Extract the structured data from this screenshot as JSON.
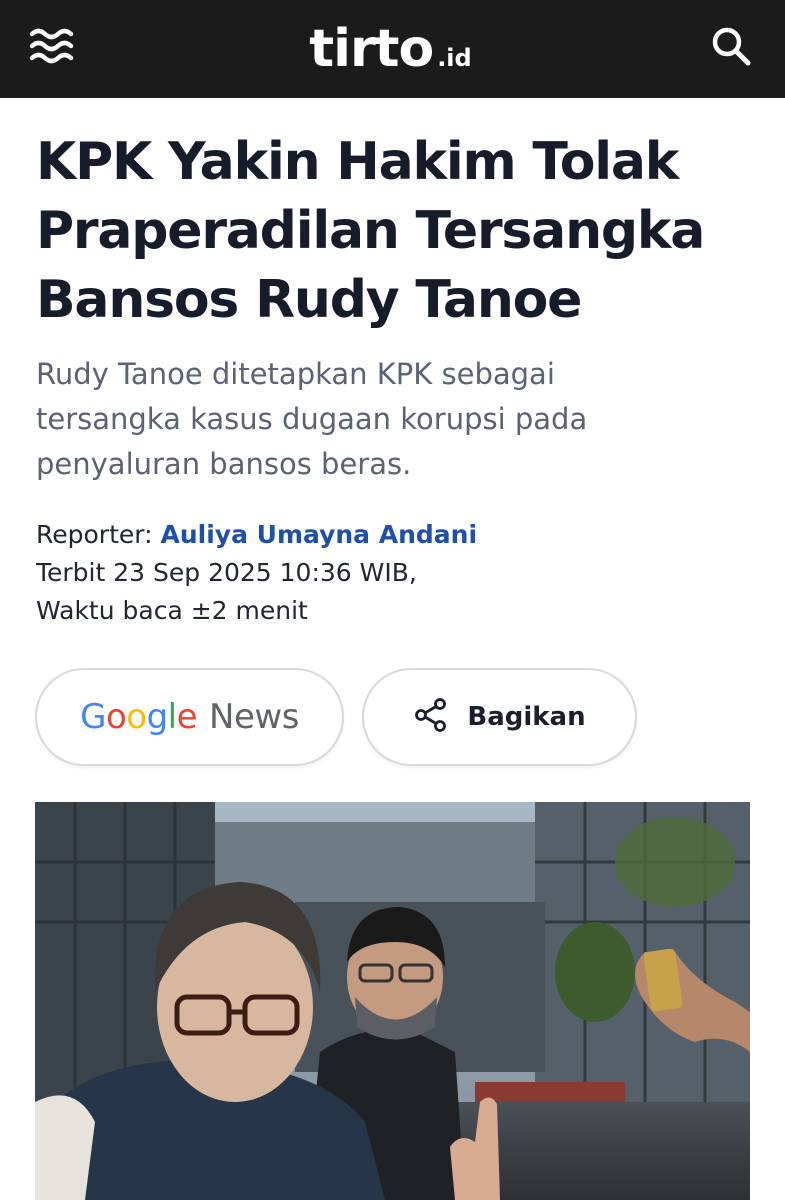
{
  "header": {
    "brand": "tirto",
    "brand_tld": ".id",
    "menu_icon": "wave-menu-icon",
    "search_icon": "search-icon",
    "background": "#1b1b1b"
  },
  "article": {
    "title": "KPK Yakin Hakim Tolak Praperadilan Tersangka Bansos Rudy Tanoe",
    "title_lines": [
      "KPK Yakin Hakim Tolak",
      "Praperadilan Tersangka",
      "Bansos Rudy Tanoe"
    ],
    "lede_lines": [
      "Rudy Tanoe ditetapkan KPK sebagai",
      "tersangka kasus dugaan korupsi pada",
      "penyaluran bansos beras."
    ],
    "reporter_label": "Reporter:",
    "reporter_name": "Auliya Umayna Andani",
    "published": "Terbit 23 Sep 2025 10:36 WIB,",
    "read_time": "Waktu baca ±2 menit"
  },
  "actions": {
    "google_news": {
      "google": "Google",
      "news": "News"
    },
    "share_label": "Bagikan",
    "share_icon": "share-icon"
  },
  "colors": {
    "reporter_link": "#1f4fa8",
    "lede": "#5b6274",
    "headline": "#171c2b"
  },
  "photo": {
    "description_icon": "article-photo"
  }
}
